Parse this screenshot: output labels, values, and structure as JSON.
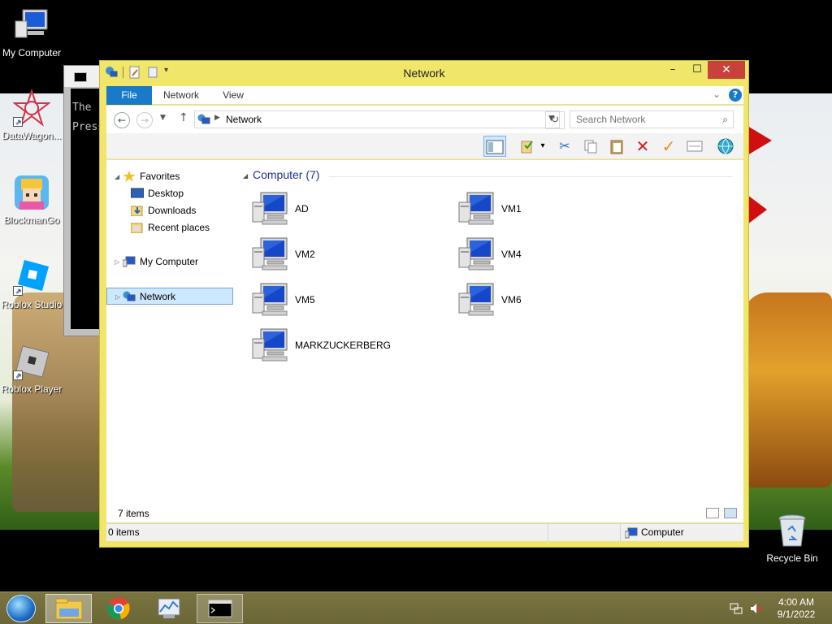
{
  "desktop": {
    "icons": [
      {
        "label": "My Computer"
      },
      {
        "label": "DataWagon..."
      },
      {
        "label": "BlockmanGo"
      },
      {
        "label": "Roblox Studio"
      },
      {
        "label": "Roblox Player"
      },
      {
        "label": "Recycle Bin"
      }
    ]
  },
  "console": {
    "lines": [
      "The",
      "Press"
    ]
  },
  "explorer": {
    "title": "Network",
    "ribbon_tabs": {
      "file": "File",
      "network": "Network",
      "view": "View"
    },
    "address": {
      "path": "Network"
    },
    "search": {
      "placeholder": "Search Network"
    },
    "nav": {
      "favorites": "Favorites",
      "desktop": "Desktop",
      "downloads": "Downloads",
      "recent": "Recent places",
      "my_computer": "My Computer",
      "network": "Network"
    },
    "group_header": "Computer (7)",
    "computers": [
      "AD",
      "VM1",
      "VM2",
      "VM4",
      "VM5",
      "VM6",
      "MARKZUCKERBERG"
    ],
    "status": {
      "item_count": "7 items",
      "selected": "0 items",
      "zone": "Computer"
    }
  },
  "taskbar": {
    "time": "4:00 AM",
    "date": "9/1/2022"
  },
  "colors": {
    "window_frame": "#f0e66a",
    "close_button": "#c8413a",
    "file_tab": "#1979ca",
    "selection": "#cce8ff",
    "group_header": "#1e3287",
    "taskbar": "#6b6636"
  }
}
